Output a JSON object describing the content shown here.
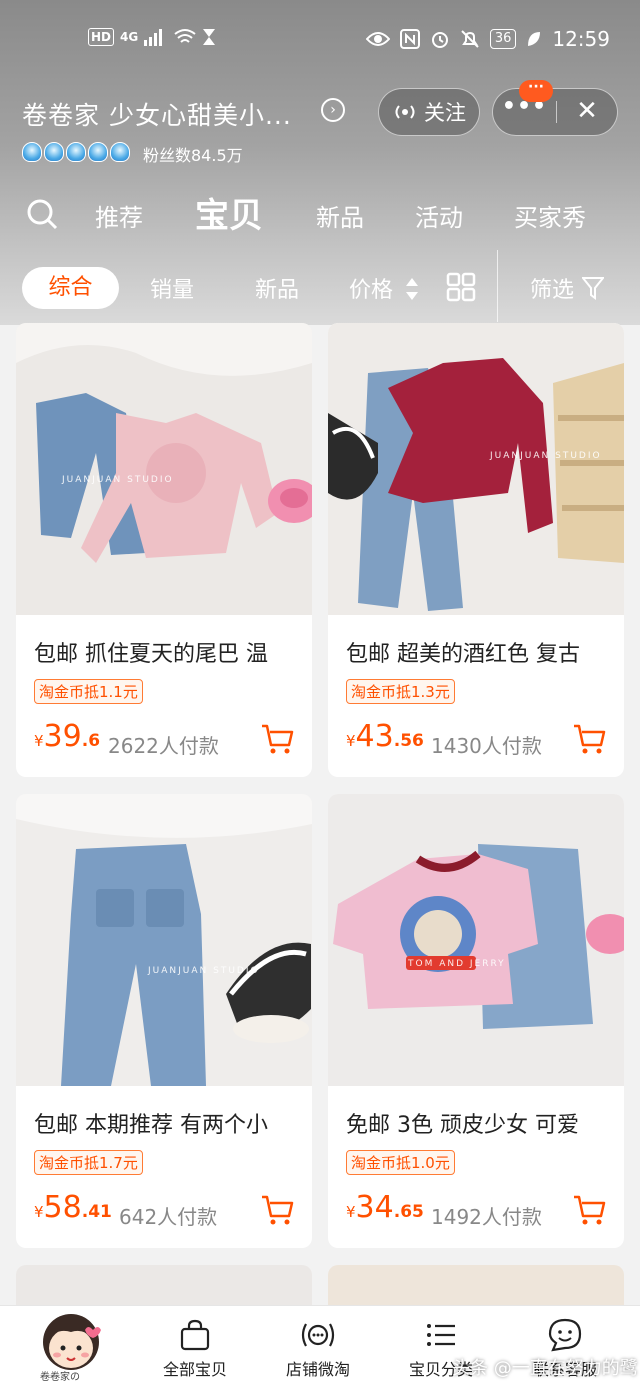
{
  "status_bar": {
    "hd": "HD",
    "network": "4G",
    "battery": "36",
    "time": "12:59"
  },
  "shop": {
    "name": "卷卷家 少女心甜美小...",
    "fans_label": "粉丝数84.5万",
    "follow_label": "关注",
    "more_label": "•••",
    "close_label": "✕",
    "badge": "···",
    "crown_count": 5
  },
  "tabs": [
    "推荐",
    "宝贝",
    "新品",
    "活动",
    "买家秀"
  ],
  "active_tab": "宝贝",
  "filters": {
    "active": "综合",
    "sales": "销量",
    "new": "新品",
    "price": "价格",
    "filter": "筛选"
  },
  "products": [
    {
      "title": "包邮 抓住夏天的尾巴 温",
      "tag": "淘金币抵1.1元",
      "currency": "¥",
      "price_int": "39",
      "price_dec": ".6",
      "sold": "2622人付款",
      "image_label": "JUANJUAN STUDIO"
    },
    {
      "title": "包邮 超美的酒红色 复古",
      "tag": "淘金币抵1.3元",
      "currency": "¥",
      "price_int": "43",
      "price_dec": ".56",
      "sold": "1430人付款",
      "image_label": "JUANJUAN STUDIO"
    },
    {
      "title": "包邮 本期推荐 有两个小",
      "tag": "淘金币抵1.7元",
      "currency": "¥",
      "price_int": "58",
      "price_dec": ".41",
      "sold": "642人付款",
      "image_label": "JUANJUAN STUDIO"
    },
    {
      "title": "免邮 3色 顽皮少女 可爱",
      "tag": "淘金币抵1.0元",
      "currency": "¥",
      "price_int": "34",
      "price_dec": ".65",
      "sold": "1492人付款",
      "image_label": "TOM AND JERRY"
    }
  ],
  "bottom_nav": {
    "avatar_label": "卷卷家の",
    "items": [
      "全部宝贝",
      "店铺微淘",
      "宝贝分类",
      "联系客服"
    ]
  },
  "watermark": "头条 @一直在努力的鹭",
  "colors": {
    "accent": "#ff5000",
    "header_gray": "#9e9e9e"
  }
}
